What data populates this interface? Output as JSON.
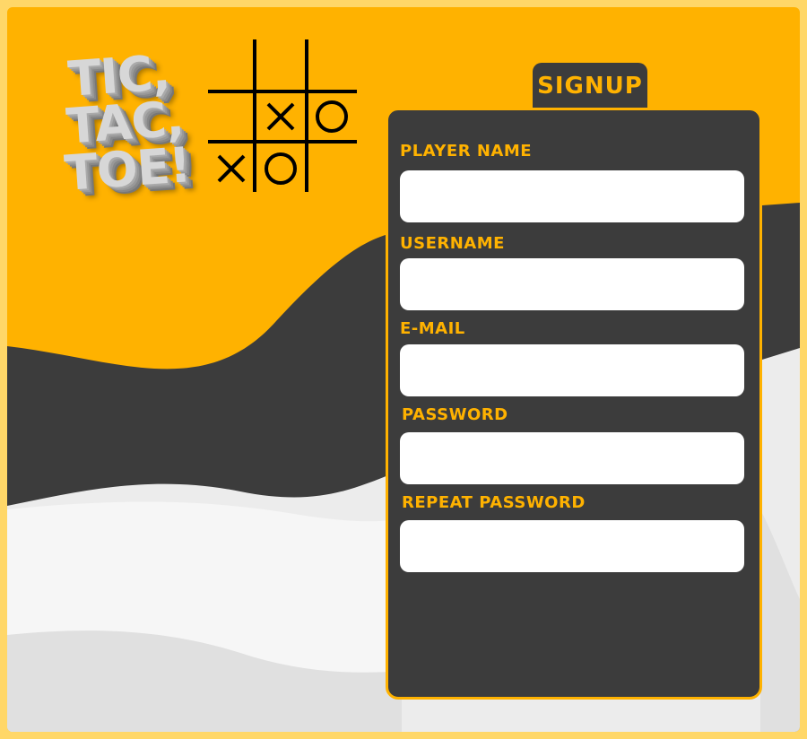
{
  "logo": {
    "lines": [
      "TIC,",
      "TAC,",
      "TOE!"
    ]
  },
  "board": {
    "cells": [
      "",
      "",
      "",
      "",
      "X",
      "O",
      "X",
      "O",
      ""
    ]
  },
  "form": {
    "title": "SIGNUP",
    "fields": [
      {
        "label": "PLAYER NAME",
        "value": "",
        "placeholder": ""
      },
      {
        "label": "USERNAME",
        "value": "",
        "placeholder": ""
      },
      {
        "label": "E-MAIL",
        "value": "",
        "placeholder": ""
      },
      {
        "label": "PASSWORD",
        "value": "",
        "placeholder": ""
      },
      {
        "label": "REPEAT PASSWORD",
        "value": "",
        "placeholder": ""
      }
    ]
  },
  "colors": {
    "accent": "#ffb200",
    "dark": "#3c3c3c",
    "light_wave": "#f2f2f2",
    "frame": "#ffd768"
  }
}
